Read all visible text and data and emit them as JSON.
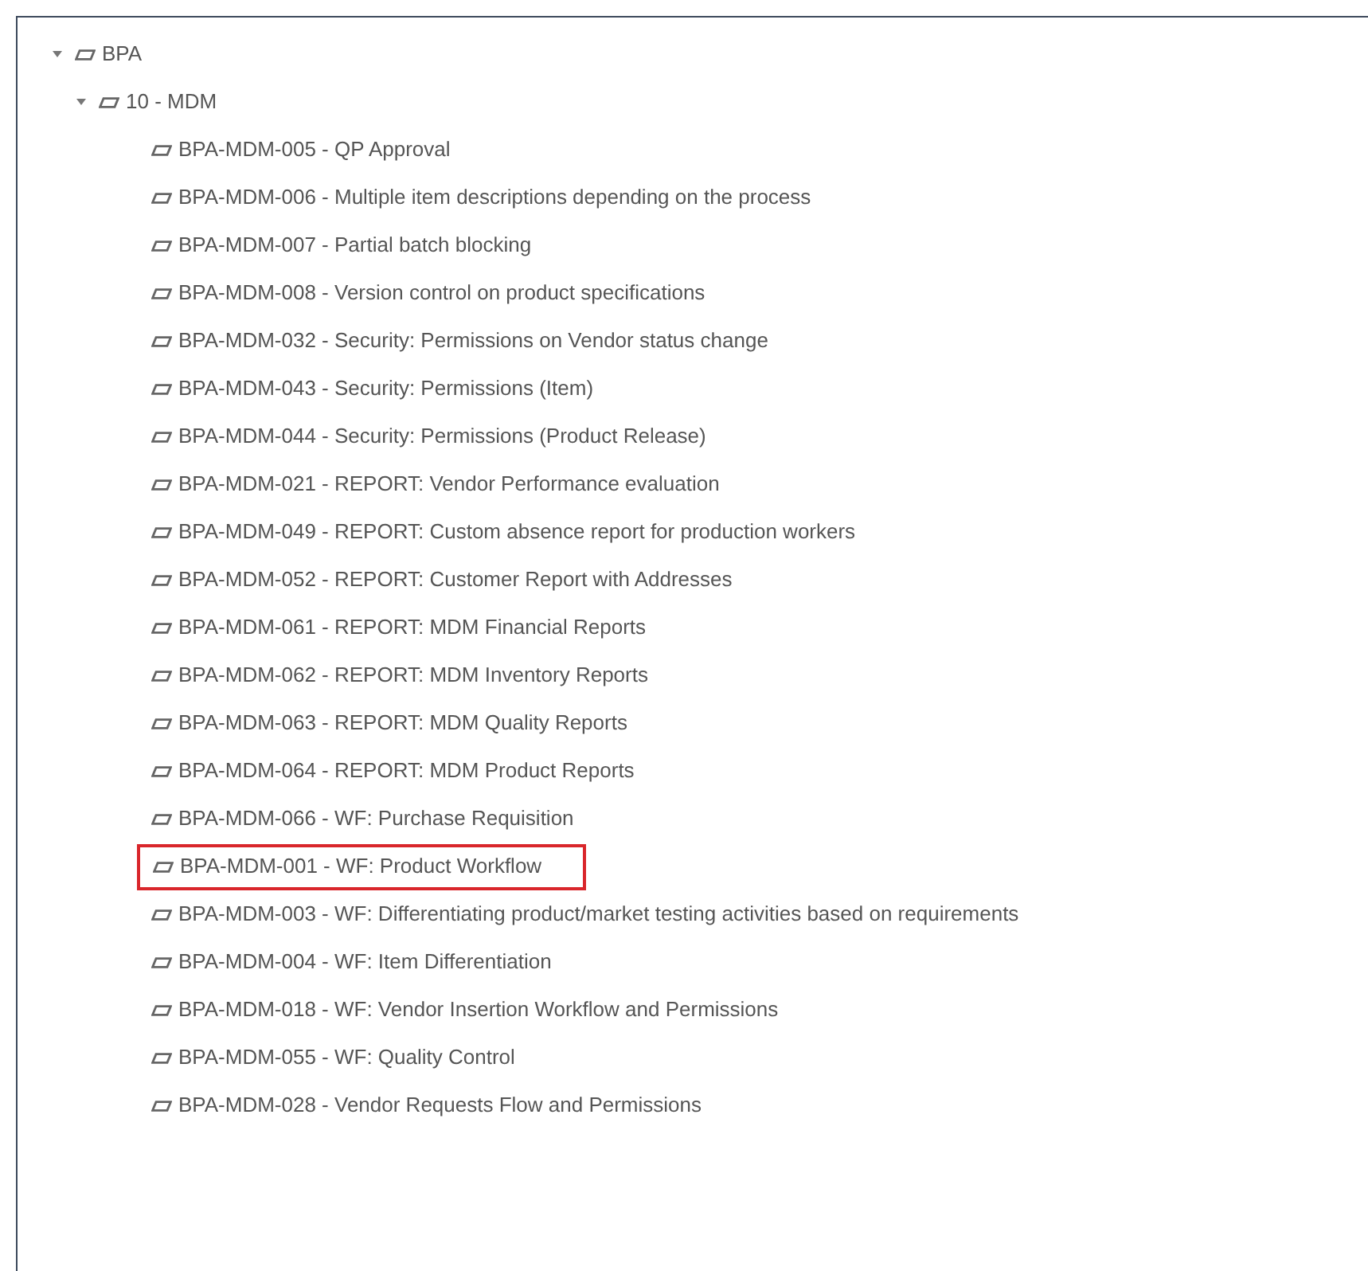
{
  "tree": [
    {
      "label": "BPA",
      "expanded": true,
      "highlighted": false,
      "children": [
        {
          "label": "10 - MDM",
          "expanded": true,
          "highlighted": false,
          "children": [
            {
              "label": "BPA-MDM-005 - QP Approval",
              "highlighted": false
            },
            {
              "label": "BPA-MDM-006 - Multiple item descriptions depending on the process",
              "highlighted": false
            },
            {
              "label": "BPA-MDM-007 - Partial batch blocking",
              "highlighted": false
            },
            {
              "label": "BPA-MDM-008 - Version control on product specifications",
              "highlighted": false
            },
            {
              "label": "BPA-MDM-032 - Security: Permissions on Vendor status change",
              "highlighted": false
            },
            {
              "label": "BPA-MDM-043 - Security: Permissions (Item)",
              "highlighted": false
            },
            {
              "label": "BPA-MDM-044 - Security: Permissions (Product Release)",
              "highlighted": false
            },
            {
              "label": "BPA-MDM-021 - REPORT: Vendor Performance evaluation",
              "highlighted": false
            },
            {
              "label": "BPA-MDM-049 - REPORT: Custom absence report for production workers",
              "highlighted": false
            },
            {
              "label": "BPA-MDM-052 - REPORT: Customer Report with Addresses",
              "highlighted": false
            },
            {
              "label": "BPA-MDM-061 - REPORT: MDM Financial Reports",
              "highlighted": false
            },
            {
              "label": "BPA-MDM-062 - REPORT: MDM Inventory Reports",
              "highlighted": false
            },
            {
              "label": "BPA-MDM-063 - REPORT: MDM Quality Reports",
              "highlighted": false
            },
            {
              "label": "BPA-MDM-064 - REPORT: MDM Product Reports",
              "highlighted": false
            },
            {
              "label": "BPA-MDM-066 - WF: Purchase Requisition",
              "highlighted": false
            },
            {
              "label": "BPA-MDM-001 - WF: Product Workflow",
              "highlighted": true
            },
            {
              "label": "BPA-MDM-003 - WF: Differentiating product/market testing activities based on requirements",
              "highlighted": false
            },
            {
              "label": "BPA-MDM-004 - WF: Item Differentiation",
              "highlighted": false
            },
            {
              "label": "BPA-MDM-018 - WF: Vendor Insertion Workflow and Permissions",
              "highlighted": false
            },
            {
              "label": "BPA-MDM-055 - WF: Quality Control",
              "highlighted": false
            },
            {
              "label": "BPA-MDM-028 - Vendor Requests Flow and Permissions",
              "highlighted": false
            }
          ]
        }
      ]
    }
  ]
}
